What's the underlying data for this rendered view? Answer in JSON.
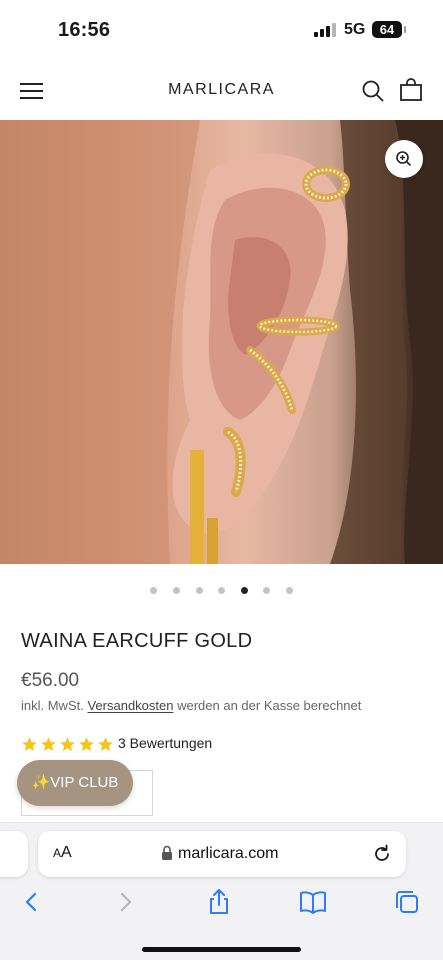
{
  "status_bar": {
    "time": "16:56",
    "network": "5G",
    "battery": "64"
  },
  "header": {
    "brand": "MARLICARA",
    "icons": [
      "hamburger-menu-icon",
      "search-icon",
      "shopping-bag-icon"
    ]
  },
  "hero": {
    "image_description_icon": "zoom-in-icon",
    "carousel_count": 7,
    "carousel_active_index": 4
  },
  "product": {
    "title": "WAINA EARCUFF GOLD",
    "price": "€56.00",
    "tax_prefix": "inkl. MwSt. ",
    "tax_link": "Versandkosten",
    "tax_suffix": " werden an der Kasse berechnet",
    "rating_stars": 5,
    "reviews": "3 Bewertungen",
    "qty_plus": "+"
  },
  "vip": {
    "label": "✨VIP CLUB"
  },
  "browser": {
    "aa_small": "A",
    "aa_large": "A",
    "url": "marlicara.com"
  },
  "colors": {
    "star": "#f5c518",
    "vip_bg": "#a59482",
    "toolbar_blue": "#2f7df6",
    "toolbar_disabled": "#b7b7bc"
  }
}
